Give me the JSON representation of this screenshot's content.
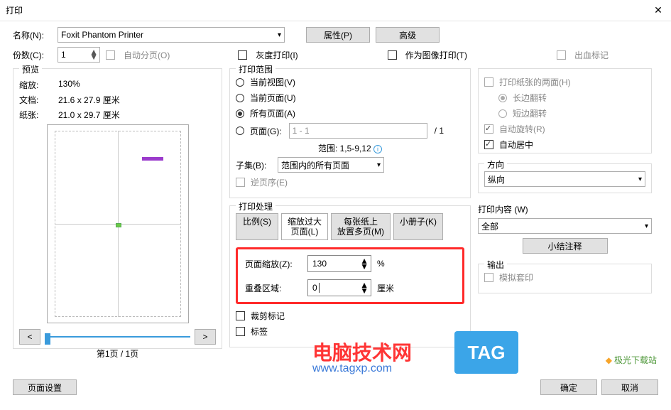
{
  "title": "打印",
  "name_label": "名称(N):",
  "printer": "Foxit Phantom Printer",
  "properties_btn": "属性(P)",
  "advanced_btn": "高级",
  "copies_label": "份数(C):",
  "copies_value": "1",
  "collate": "自动分页(O)",
  "gray_print": "灰度打印(I)",
  "as_image": "作为图像打印(T)",
  "bleed_marks": "出血标记",
  "preview": {
    "legend": "预览",
    "scale_label": "缩放:",
    "scale_value": "130%",
    "doc_label": "文档:",
    "doc_value": "21.6 x 27.9 厘米",
    "paper_label": "纸张:",
    "paper_value": "21.0 x 29.7 厘米",
    "page_indicator": "第1页 / 1页",
    "prev": "<",
    "next": ">"
  },
  "range": {
    "legend": "打印范围",
    "current_view": "当前视图(V)",
    "current_page": "当前页面(U)",
    "all_pages": "所有页面(A)",
    "pages": "页面(G):",
    "pages_value": "1 - 1",
    "total": "/ 1",
    "example": "范围: 1,5-9,12",
    "subset_label": "子集(B):",
    "subset_value": "范围内的所有页面",
    "reverse": "逆页序(E)"
  },
  "handling": {
    "legend": "打印处理",
    "tab_scale": "比例(S)",
    "tab_fit": "缩放过大\n页面(L)",
    "tab_multiple": "每张纸上\n放置多页(M)",
    "tab_booklet": "小册子(K)",
    "page_scale_label": "页面缩放(Z):",
    "page_scale_value": "130",
    "percent": "%",
    "overlap_label": "重叠区域:",
    "overlap_value": "0",
    "unit": "厘米",
    "crop_marks": "裁剪标记",
    "labels": "标签"
  },
  "right": {
    "both_sides": "打印纸张的两面(H)",
    "long_edge": "长边翻转",
    "short_edge": "短边翻转",
    "auto_rotate": "自动旋转(R)",
    "auto_center": "自动居中",
    "orientation_legend": "方向",
    "orientation_value": "纵向",
    "content_label": "打印内容 (W)",
    "content_value": "全部",
    "summary_btn": "小结注释",
    "output_legend": "输出",
    "simulate": "模拟套印"
  },
  "page_setup_btn": "页面设置",
  "ok_btn": "确定",
  "cancel_btn": "取消",
  "watermark": "电脑技术网",
  "watermark_url": "www.tagxp.com",
  "tag": "TAG",
  "logo": "极光下载站"
}
